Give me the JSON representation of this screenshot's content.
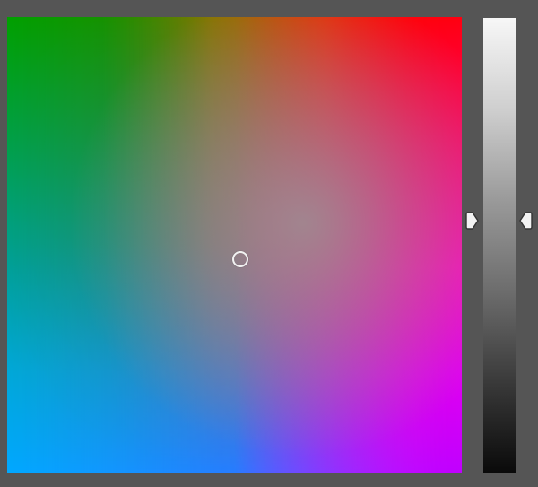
{
  "picker": {
    "field_colors": {
      "top_left": "#00a000",
      "top_mid": "#c08000",
      "top_right": "#ff0010",
      "right_mid": "#ff00c0",
      "bottom_right": "#c000ff",
      "bottom_mid": "#0090ff",
      "bottom_left": "#00a8ff",
      "center": "#a08888"
    },
    "lightness_slider": {
      "top_color": "#f7f7f7",
      "bottom_color": "#0a0a0a",
      "value": 0.54
    },
    "selected_position": {
      "saturation": 0.5,
      "hue_axis": 0.5
    },
    "icons": {
      "left_handle": "arrow-right-icon",
      "right_handle": "arrow-left-icon",
      "cursor": "circle-cursor-icon"
    }
  }
}
